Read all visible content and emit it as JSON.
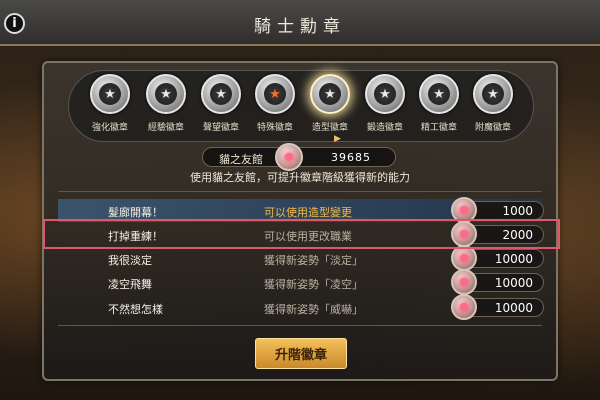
{
  "header": {
    "title": "騎士勳章",
    "info_icon": "i"
  },
  "badges": [
    {
      "label": "強化徽章",
      "icon": "star",
      "selected": false,
      "special": false
    },
    {
      "label": "經驗徽章",
      "icon": "star",
      "selected": false,
      "special": false
    },
    {
      "label": "聲望徽章",
      "icon": "star",
      "selected": false,
      "special": false
    },
    {
      "label": "特殊徽章",
      "icon": "star",
      "selected": false,
      "special": true
    },
    {
      "label": "造型徽章",
      "icon": "star",
      "selected": true,
      "special": false
    },
    {
      "label": "鍛造徽章",
      "icon": "star",
      "selected": false,
      "special": false
    },
    {
      "label": "精工徽章",
      "icon": "star",
      "selected": false,
      "special": false
    },
    {
      "label": "附魔徽章",
      "icon": "star",
      "selected": false,
      "special": false
    }
  ],
  "currency": {
    "name": "貓之友館",
    "value": "39685",
    "icon": "gem-medal-icon"
  },
  "description": "使用貓之友館，可提升徽章階級獲得新的能力",
  "rows": [
    {
      "name": "髮廊開幕！",
      "desc": "可以使用造型變更",
      "cost": "1000",
      "active": true
    },
    {
      "name": "打掉重練！",
      "desc": "可以使用更改職業",
      "cost": "2000",
      "active": false
    },
    {
      "name": "我很淡定",
      "desc": "獲得新姿勢「淡定」",
      "cost": "10000",
      "active": false
    },
    {
      "name": "凌空飛舞",
      "desc": "獲得新姿勢「凌空」",
      "cost": "10000",
      "active": false
    },
    {
      "name": "不然想怎樣",
      "desc": "獲得新姿勢「威嚇」",
      "cost": "10000",
      "active": false
    }
  ],
  "upgrade_button": {
    "label": "升階徽章"
  },
  "colors": {
    "highlight": "#e0566a",
    "active_text": "#f2b94e",
    "button": "#f4c15a"
  }
}
